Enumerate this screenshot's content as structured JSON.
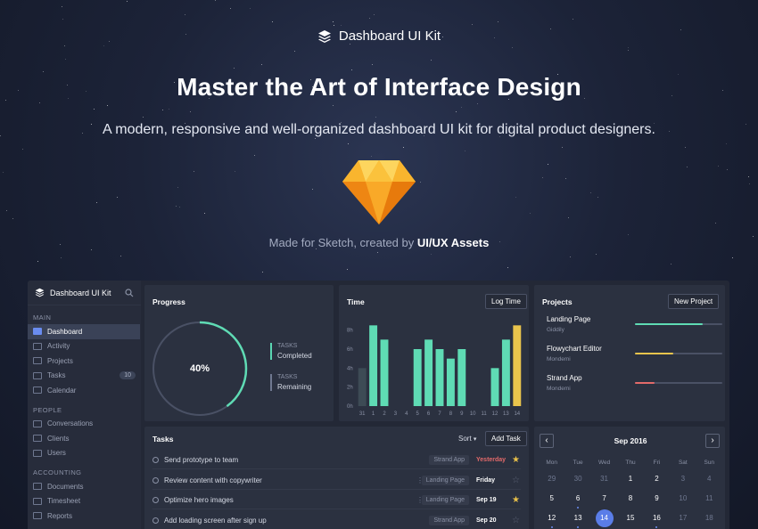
{
  "hero": {
    "brand": "Dashboard UI Kit",
    "title": "Master the Art of Interface Design",
    "subtitle": "A modern, responsive and well-organized dashboard UI kit for digital product designers.",
    "credit_prefix": "Made for Sketch, created by",
    "credit_author": "UI/UX Assets"
  },
  "sidebar": {
    "brand": "Dashboard UI Kit",
    "sections": [
      {
        "label": "MAIN",
        "items": [
          {
            "label": "Dashboard",
            "icon": "grid-icon"
          },
          {
            "label": "Activity",
            "icon": "list-icon"
          },
          {
            "label": "Projects",
            "icon": "folder-icon"
          },
          {
            "label": "Tasks",
            "icon": "check-icon",
            "badge": "10"
          },
          {
            "label": "Calendar",
            "icon": "calendar-icon"
          }
        ]
      },
      {
        "label": "PEOPLE",
        "items": [
          {
            "label": "Conversations",
            "icon": "chat-icon"
          },
          {
            "label": "Clients",
            "icon": "id-card-icon"
          },
          {
            "label": "Users",
            "icon": "user-icon"
          }
        ]
      },
      {
        "label": "ACCOUNTING",
        "items": [
          {
            "label": "Documents",
            "icon": "document-icon"
          },
          {
            "label": "Timesheet",
            "icon": "clock-icon"
          },
          {
            "label": "Reports",
            "icon": "bar-chart-icon"
          }
        ]
      }
    ]
  },
  "progress": {
    "title": "Progress",
    "value": "40%",
    "fraction": 0.4,
    "legend": [
      {
        "label": "TASKS",
        "value": "Completed"
      },
      {
        "label": "TASKS",
        "value": "Remaining"
      }
    ]
  },
  "time": {
    "title": "Time",
    "button": "Log Time"
  },
  "chart_data": {
    "type": "bar",
    "categories": [
      "31",
      "1",
      "2",
      "3",
      "4",
      "5",
      "6",
      "7",
      "8",
      "9",
      "10",
      "11",
      "12",
      "13",
      "14"
    ],
    "values": [
      4,
      8.5,
      7,
      0,
      0,
      6,
      7,
      6,
      5,
      6,
      0,
      0,
      4,
      7,
      8.5
    ],
    "y_ticks": [
      "0h",
      "2h",
      "4h",
      "6h",
      "8h"
    ],
    "ylim": [
      0,
      9
    ],
    "colors": [
      "#3d4b55",
      "#5fdbb4",
      "#5fdbb4",
      "#5fdbb4",
      "#5fdbb4",
      "#5fdbb4",
      "#5fdbb4",
      "#5fdbb4",
      "#5fdbb4",
      "#5fdbb4",
      "#5fdbb4",
      "#5fdbb4",
      "#5fdbb4",
      "#5fdbb4",
      "#e9c44c"
    ]
  },
  "projects": {
    "title": "Projects",
    "button": "New Project",
    "items": [
      {
        "name": "Landing Page",
        "client": "Giddily",
        "progress": 0.78,
        "color": "#5fdbb4"
      },
      {
        "name": "Flowychart Editor",
        "client": "Mondemi",
        "progress": 0.44,
        "color": "#e9c44c"
      },
      {
        "name": "Strand App",
        "client": "Mondemi",
        "progress": 0.22,
        "color": "#e36a6a"
      }
    ]
  },
  "tasks": {
    "title": "Tasks",
    "sort_label": "Sort",
    "button": "Add Task",
    "items": [
      {
        "text": "Send prototype to team",
        "tag": "Strand App",
        "date": "Yesterday",
        "date_color": "#e36a6a",
        "starred": true,
        "clip": false
      },
      {
        "text": "Review content with copywriter",
        "tag": "Landing Page",
        "date": "Friday",
        "date_color": "#ffffff",
        "starred": false,
        "clip": true
      },
      {
        "text": "Optimize hero images",
        "tag": "Landing Page",
        "date": "Sep 19",
        "date_color": "#ffffff",
        "starred": true,
        "clip": true
      },
      {
        "text": "Add loading screen after sign up",
        "tag": "Strand App",
        "date": "Sep 20",
        "date_color": "#ffffff",
        "starred": false,
        "clip": false
      }
    ]
  },
  "calendar": {
    "month": "Sep 2016",
    "prev": "‹",
    "next": "›",
    "days": [
      "Mon",
      "Tue",
      "Wed",
      "Thu",
      "Fri",
      "Sat",
      "Sun"
    ],
    "weeks": [
      [
        {
          "d": "29",
          "m": true
        },
        {
          "d": "30",
          "m": true
        },
        {
          "d": "31",
          "m": true
        },
        {
          "d": "1"
        },
        {
          "d": "2"
        },
        {
          "d": "3",
          "m": true
        },
        {
          "d": "4",
          "m": true
        }
      ],
      [
        {
          "d": "5"
        },
        {
          "d": "6",
          "dot": true
        },
        {
          "d": "7"
        },
        {
          "d": "8"
        },
        {
          "d": "9"
        },
        {
          "d": "10",
          "m": true
        },
        {
          "d": "11",
          "m": true
        }
      ],
      [
        {
          "d": "12",
          "dot": true
        },
        {
          "d": "13",
          "dot": true
        },
        {
          "d": "14",
          "today": true
        },
        {
          "d": "15"
        },
        {
          "d": "16",
          "dot": true
        },
        {
          "d": "17",
          "m": true
        },
        {
          "d": "18",
          "m": true
        }
      ]
    ]
  }
}
